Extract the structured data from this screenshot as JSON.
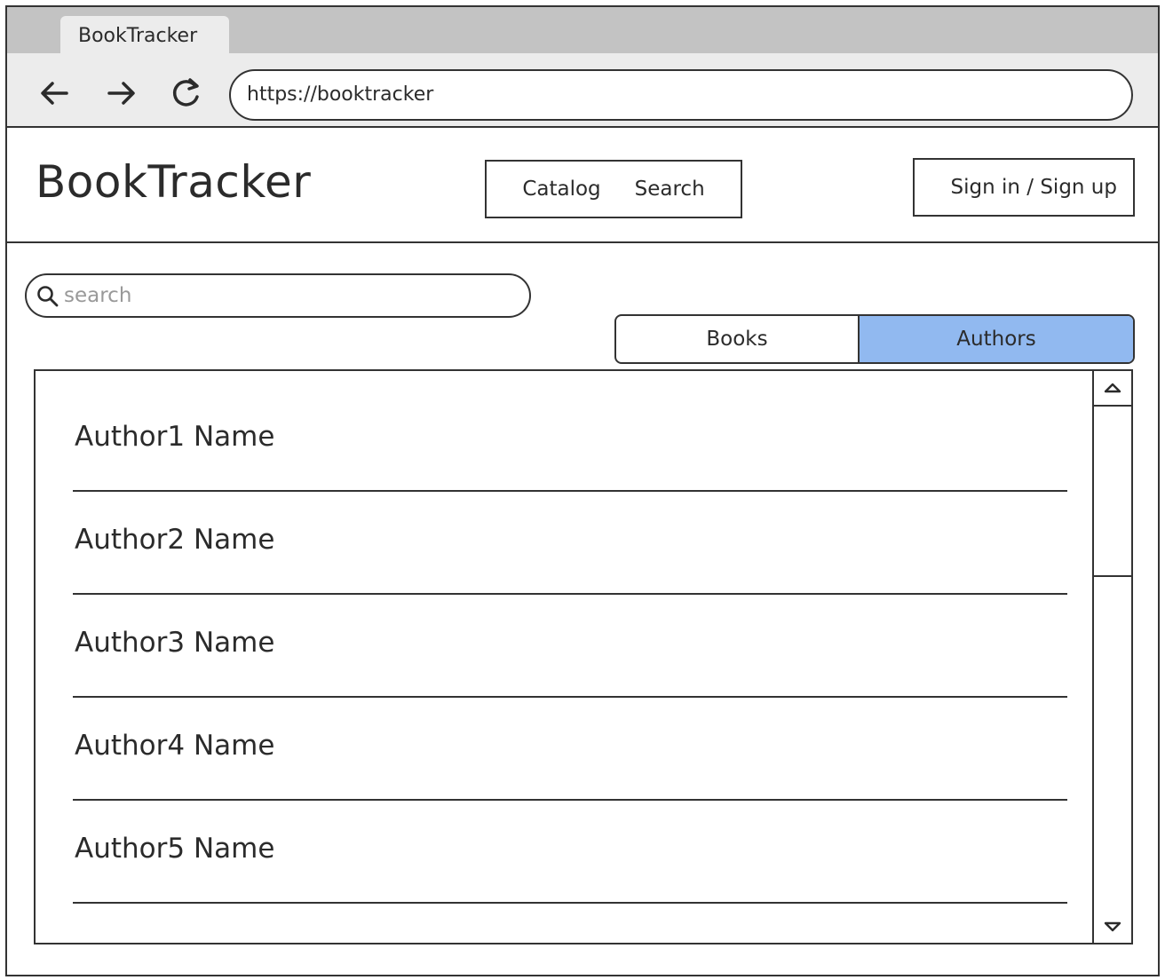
{
  "browser": {
    "tab_title": "BookTracker",
    "url": "https://booktracker"
  },
  "header": {
    "app_title": "BookTracker",
    "nav": {
      "catalog": "Catalog",
      "search": "Search"
    },
    "auth_label": "Sign in / Sign up"
  },
  "search": {
    "placeholder": "search",
    "value": ""
  },
  "segmented": {
    "books": "Books",
    "authors": "Authors",
    "selected": "Authors",
    "selected_color": "#91b9f0"
  },
  "authors": [
    {
      "name": "Author1 Name"
    },
    {
      "name": "Author2 Name"
    },
    {
      "name": "Author3 Name"
    },
    {
      "name": "Author4 Name"
    },
    {
      "name": "Author5 Name"
    }
  ],
  "icons": {
    "back": "back-arrow-icon",
    "forward": "forward-arrow-icon",
    "reload": "reload-icon",
    "search": "search-icon",
    "scroll_up": "scroll-up-icon",
    "scroll_down": "scroll-down-icon"
  }
}
